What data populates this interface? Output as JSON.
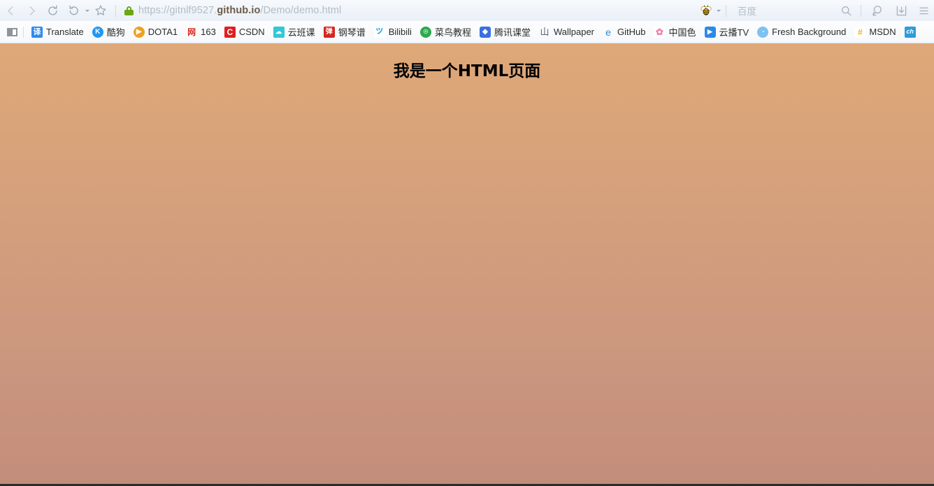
{
  "browser": {
    "nav": {
      "back": "back-arrow",
      "forward": "forward-arrow",
      "reload": "reload",
      "history": "history-back",
      "bookmark_star": "star"
    },
    "address": {
      "security": "secure-lock",
      "url_scheme": "https://",
      "url_subdomain": "gitnlf9527.",
      "url_domain": "github.io",
      "url_path": "/Demo/demo.html",
      "url_full": "https://gitnlf9527.github.io/Demo/demo.html"
    },
    "search": {
      "engine_icon": "bee-icon",
      "engine_name": "百度",
      "placeholder": "百度",
      "value": "",
      "submit_icon": "search-icon"
    },
    "right_tools": [
      {
        "name": "screenshot-icon",
        "glyph": "screenshot"
      },
      {
        "name": "download-icon",
        "glyph": "download"
      },
      {
        "name": "menu-icon",
        "glyph": "hamburger"
      }
    ]
  },
  "bookmarks_bar": {
    "panel_toggle": "sidebar-toggle",
    "items": [
      {
        "label": "Translate",
        "icon": "translate-icon",
        "mark": "译",
        "cls": "fi-translate"
      },
      {
        "label": "酷狗",
        "icon": "kugou-icon",
        "mark": "K",
        "cls": "fi-kugou"
      },
      {
        "label": "DOTA1",
        "icon": "dota-icon",
        "mark": "▶",
        "cls": "fi-dota"
      },
      {
        "label": "163",
        "icon": "netease-icon",
        "mark": "网",
        "cls": "fi-163"
      },
      {
        "label": "CSDN",
        "icon": "csdn-icon",
        "mark": "C",
        "cls": "fi-csdn"
      },
      {
        "label": "云班课",
        "icon": "yunbanke-icon",
        "mark": "☁",
        "cls": "fi-yunban"
      },
      {
        "label": "钢琴谱",
        "icon": "gangqinpu-icon",
        "mark": "弹",
        "cls": "fi-piano"
      },
      {
        "label": "Bilibili",
        "icon": "bilibili-icon",
        "mark": "ツ",
        "cls": "fi-bili"
      },
      {
        "label": "菜鸟教程",
        "icon": "runoob-icon",
        "mark": "☉",
        "cls": "fi-cainiao"
      },
      {
        "label": "腾讯课堂",
        "icon": "tencent-ke-icon",
        "mark": "◆",
        "cls": "fi-tencent"
      },
      {
        "label": "Wallpaper",
        "icon": "wallpaper-icon",
        "mark": "山",
        "cls": "fi-wall"
      },
      {
        "label": "GitHub",
        "icon": "github-icon",
        "mark": "e",
        "cls": "fi-github"
      },
      {
        "label": "中国色",
        "icon": "zhongguose-icon",
        "mark": "✿",
        "cls": "fi-color"
      },
      {
        "label": "云播TV",
        "icon": "yunbo-tv-icon",
        "mark": "▶",
        "cls": "fi-yunbo"
      },
      {
        "label": "Fresh Background",
        "icon": "fresh-bg-icon",
        "mark": "◔",
        "cls": "fi-fresh"
      },
      {
        "label": "MSDN",
        "icon": "msdn-icon",
        "mark": "#",
        "cls": "fi-msdn"
      },
      {
        "label": "",
        "icon": "ch-icon",
        "mark": "ch",
        "cls": "fi-ch"
      }
    ]
  },
  "page": {
    "heading": "我是一个HTML页面",
    "background_top": "#dfa878",
    "background_bottom": "#c38d7c",
    "heading_color": "#000000"
  }
}
